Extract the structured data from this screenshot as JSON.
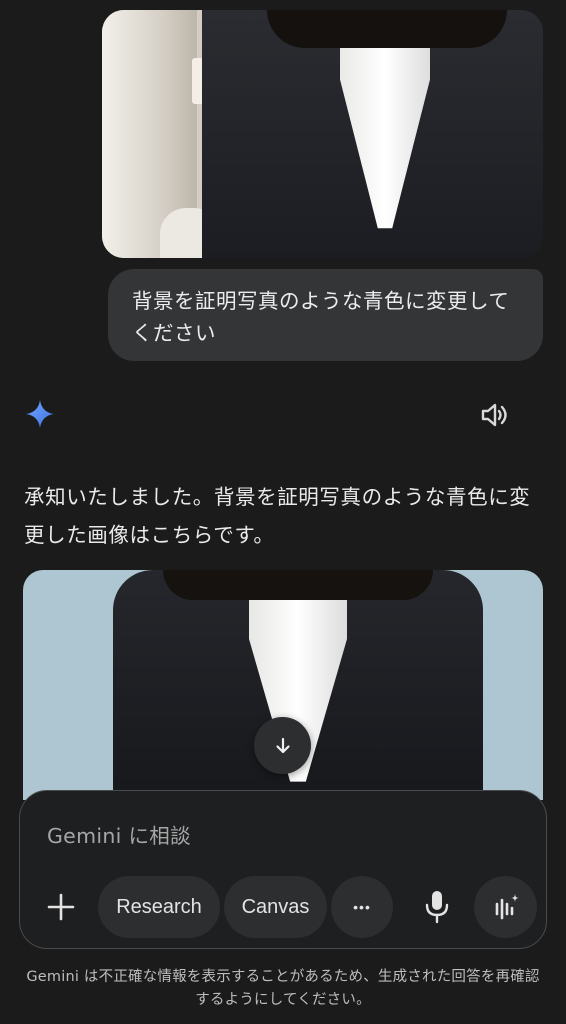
{
  "conversation": {
    "user_image": {
      "icon": "photo-woman-in-black-suit-room-background"
    },
    "user_message": "背景を証明写真のような青色に変更してください",
    "response": {
      "text": "承知いたしました。背景を証明写真のような青色に変更した画像はこちらです。",
      "generated_image": {
        "icon": "photo-woman-in-black-suit-blue-background"
      }
    }
  },
  "icons": {
    "assistant": "gemini-spark-icon",
    "speaker": "speaker-icon",
    "download": "arrow-down-icon",
    "plus": "plus-icon",
    "more": "more-horizontal-icon",
    "mic": "microphone-icon",
    "live": "live-waveform-icon"
  },
  "composer": {
    "placeholder": "Gemini に相談",
    "chips": {
      "research": "Research",
      "canvas": "Canvas",
      "more": "•••"
    }
  },
  "footer": {
    "disclaimer": "Gemini は不正確な情報を表示することがあるため、生成された回答を再確認するようにしてください。"
  },
  "colors": {
    "background": "#1b1b1c",
    "bubble": "#333537",
    "chip": "#2d2e30",
    "spark_blue": "#4e8cf7",
    "generated_bg": "#aec6d2"
  }
}
